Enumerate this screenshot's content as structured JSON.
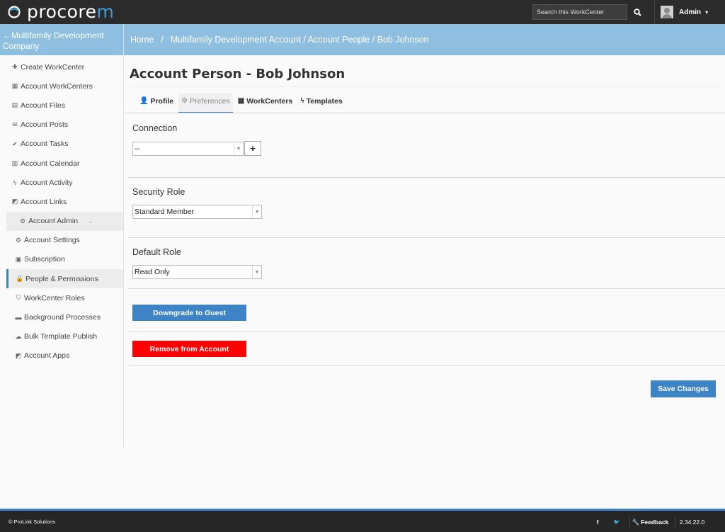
{
  "header": {
    "logo_text_main": "procore",
    "logo_text_accent": "m",
    "search_placeholder": "Search this WorkCenter",
    "admin_label": "Admin",
    "admin_caret": "▾"
  },
  "breadcrumb": {
    "items": [
      "Home",
      "Multifamily Development Account / Account People / Bob Johnson"
    ],
    "separator": "/"
  },
  "sidebar": {
    "back_arrow": "←",
    "header": "Multifamily Development Company",
    "items": [
      {
        "icon": "✚",
        "label": "Create WorkCenter"
      },
      {
        "icon": "▦",
        "label": "Account WorkCenters"
      },
      {
        "icon": "▤",
        "label": "Account Files"
      },
      {
        "icon": "✉",
        "label": "Account Posts"
      },
      {
        "icon": "✔",
        "label": "Account Tasks"
      },
      {
        "icon": "▥",
        "label": "Account Calendar"
      },
      {
        "icon": "ϟ",
        "label": "Account Activity"
      },
      {
        "icon": "◩",
        "label": "Account Links"
      },
      {
        "icon": "⚙",
        "label": "Account Admin"
      },
      {
        "icon": "⚙",
        "label": "Account Settings"
      },
      {
        "icon": "▣",
        "label": "Subscription"
      },
      {
        "icon": "🔒",
        "label": "People & Permissions"
      },
      {
        "icon": "⛉",
        "label": "WorkCenter Roles"
      },
      {
        "icon": "▬",
        "label": "Background Processes"
      },
      {
        "icon": "☁",
        "label": "Bulk Template Publish"
      },
      {
        "icon": "◩",
        "label": "Account Apps"
      }
    ],
    "group_chevron": "⌄"
  },
  "main": {
    "title": "Account Person - Bob Johnson",
    "tabs": [
      {
        "icon": "👤",
        "label": "Profile"
      },
      {
        "icon": "⚙",
        "label": "Preferences"
      },
      {
        "icon": "▦",
        "label": "WorkCenters"
      },
      {
        "icon": "ϟ",
        "label": "Templates"
      }
    ],
    "connection": {
      "label": "Connection",
      "value": "--",
      "add": "+"
    },
    "security_role": {
      "label": "Security Role",
      "value": "Standard Member"
    },
    "default_role": {
      "label": "Default Role",
      "value": "Read Only"
    },
    "downgrade_button": "Downgrade to Guest",
    "remove_button": "Remove from Account",
    "save_button": "Save Changes"
  },
  "footer": {
    "copyright": "© ProLink Solutions",
    "facebook": "f",
    "twitter": "🐦",
    "feedback": "Feedback",
    "version": "2.34.22.0"
  },
  "colors": {
    "accent_blue": "#3d84c6",
    "breadcrumb_bg": "#8fbfe0",
    "danger_red": "#ff0000",
    "topbar_bg": "#2b2b2b"
  }
}
